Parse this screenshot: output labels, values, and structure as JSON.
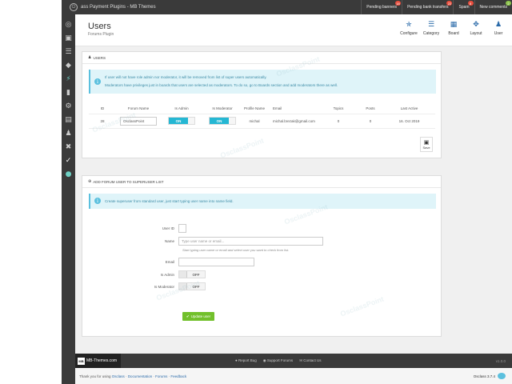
{
  "topbar": {
    "brand": "ass Payment Plugins - MB Themes",
    "buttons": [
      {
        "label": "Pending banners",
        "badge": "18"
      },
      {
        "label": "Pending bank transfers",
        "badge": "22"
      },
      {
        "label": "Spam",
        "badge": "8"
      },
      {
        "label": "New comments",
        "badge": "2"
      }
    ]
  },
  "rail": {
    "icons": [
      "dashboard-icon",
      "bank-icon",
      "list-icon",
      "tag-icon",
      "plug-icon",
      "stats-icon",
      "cogs-icon",
      "pages-icon",
      "user-icon",
      "tools-icon",
      "check-icon",
      "toggle-icon"
    ]
  },
  "header": {
    "title": "Users",
    "subtitle": "Forums Plugin",
    "tools": [
      {
        "label": "Configure",
        "icon": "wrench-icon"
      },
      {
        "label": "Category",
        "icon": "list-icon"
      },
      {
        "label": "Board",
        "icon": "grid-icon"
      },
      {
        "label": "Layout",
        "icon": "move-icon"
      },
      {
        "label": "User",
        "icon": "user-icon"
      }
    ]
  },
  "users_panel": {
    "heading": "USERS",
    "info_line1": "If user will not have role admin nor moderator, it will be removed from list of super users automatically.",
    "info_line2": "Moderators have privileges just in boards that users are selected as moderators. To do so, go to Boards section and add moderators there as well.",
    "columns": [
      "ID",
      "Forum Name",
      "Is Admin",
      "Is Moderator",
      "Profile Name",
      "Email",
      "Topics",
      "Posts",
      "Last Active"
    ],
    "rows": [
      {
        "id": "28",
        "forum_name": "OsclassPoint",
        "is_admin": "ON",
        "is_moderator": "ON",
        "profile_name": "michal",
        "email": "michal.brezak@gmail.com",
        "topics": "0",
        "posts": "0",
        "last_active": "16. Oct 2019"
      }
    ],
    "save_label": "Save"
  },
  "add_panel": {
    "heading": "ADD FORUM USER TO SUPERUSER LIST",
    "info": "Create superuser from standard user, just start typing user name into name field.",
    "user_id_label": "User ID",
    "name_label": "Name",
    "name_placeholder": "Type user name or email...",
    "name_hint": "Start typing user name or email and select user you want to check from list.",
    "email_label": "Email",
    "is_admin_label": "Is Admin",
    "is_admin_value": "OFF",
    "is_moderator_label": "Is Moderator",
    "is_moderator_value": "OFF",
    "update_label": "Update user"
  },
  "footer": {
    "logo_text": "MB-Themes.com",
    "links": [
      "Report Bug",
      "Support Forums",
      "Contact Us"
    ],
    "version": "v1.0.0",
    "thanks_prefix": "Thank you for using",
    "osclass_link": "Osclass",
    "documentation": "Documentation",
    "forums": "Forums",
    "feedback": "Feedback",
    "osclass_version": "Osclass 3.7.4"
  },
  "watermark": "OsclassPoint",
  "colors": {
    "accent": "#25b7d3",
    "topbar": "#3a3a3a",
    "update_button": "#72c02c",
    "info_bg": "#dff4f9"
  }
}
